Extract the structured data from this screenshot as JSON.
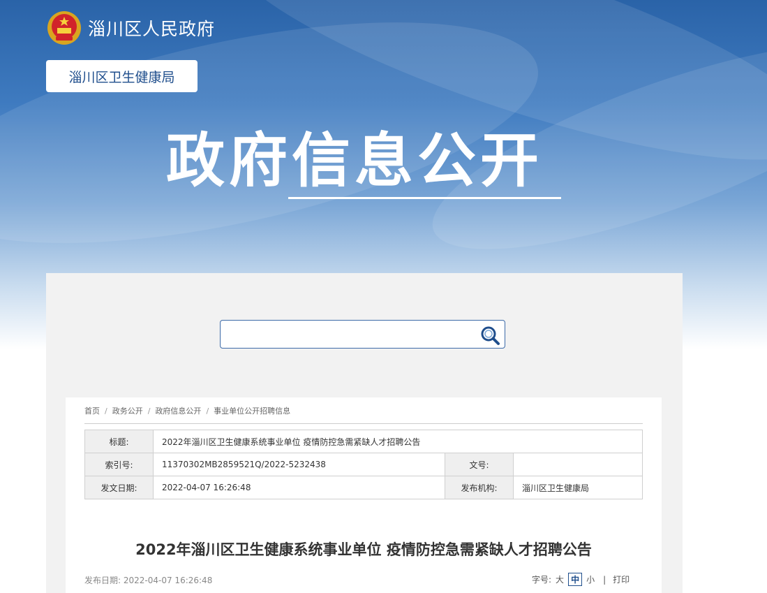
{
  "header": {
    "site_name": "淄川区人民政府",
    "department": "淄川区卫生健康局",
    "banner_title": "政府信息公开"
  },
  "search": {
    "placeholder": "",
    "icon": "search-icon"
  },
  "breadcrumb": [
    "首页",
    "政务公开",
    "政府信息公开",
    "事业单位公开招聘信息"
  ],
  "meta": {
    "title_label": "标题:",
    "title_value": "2022年淄川区卫生健康系统事业单位 疫情防控急需紧缺人才招聘公告",
    "index_label": "索引号:",
    "index_value": "11370302MB2859521Q/2022-5232438",
    "doc_no_label": "文号:",
    "doc_no_value": "",
    "date_label": "发文日期:",
    "date_value": "2022-04-07 16:26:48",
    "org_label": "发布机构:",
    "org_value": "淄川区卫生健康局"
  },
  "article": {
    "title": "2022年淄川区卫生健康系统事业单位 疫情防控急需紧缺人才招聘公告",
    "pub_label": "发布日期:",
    "pub_date": "2022-04-07 16:26:48"
  },
  "font_size": {
    "label": "字号:",
    "large": "大",
    "medium": "中",
    "small": "小",
    "print": "打印"
  },
  "colors": {
    "brand_blue": "#1f4e8c",
    "banner_blue": "#2a63a8"
  }
}
